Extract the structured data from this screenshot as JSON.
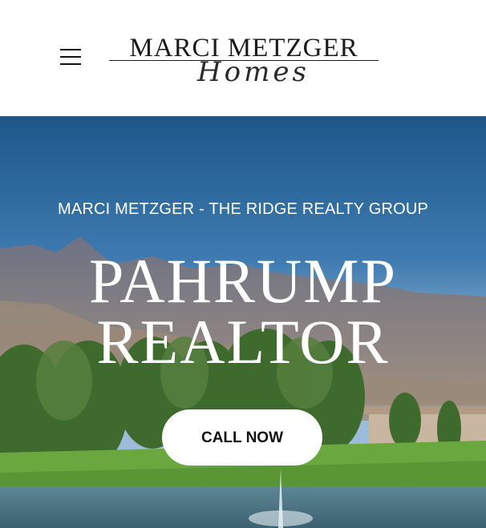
{
  "header": {
    "menu_icon": "hamburger-menu-icon",
    "logo": {
      "name": "MARCI METZGER",
      "script": "Homes"
    }
  },
  "hero": {
    "subtitle": "MARCI METZGER - THE RIDGE REALTY GROUP",
    "title_line1": "PAHRUMP",
    "title_line2": "REALTOR",
    "cta_label": "CALL NOW"
  },
  "colors": {
    "header_bg": "#ffffff",
    "sky_top": "#1f5a8c",
    "sky_bottom": "#8fb3d6",
    "mountain": "#8a8c9a",
    "grass": "#5e9a3a",
    "water": "#4f7a8a",
    "cta_bg": "#ffffff",
    "cta_text": "#111111"
  }
}
